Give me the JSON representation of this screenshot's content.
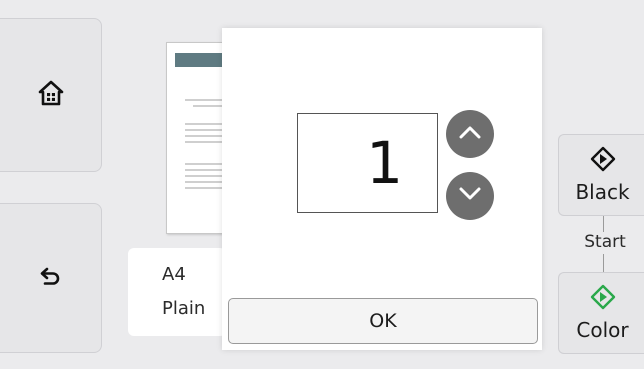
{
  "left_nav": {
    "home_icon": "home-icon",
    "back_icon": "back-arrow-icon"
  },
  "paper": {
    "size": "A4",
    "type": "Plain"
  },
  "copies": {
    "value": "1",
    "up_icon": "chevron-up-icon",
    "down_icon": "chevron-down-icon",
    "ok_label": "OK"
  },
  "start": {
    "label": "Start",
    "black_label": "Black",
    "color_label": "Color",
    "black_icon": "start-diamond-icon",
    "color_icon": "start-diamond-icon"
  },
  "colors": {
    "background": "#ebebed",
    "arrow_button": "#6e6e6e",
    "color_start_accent": "#2aa84a",
    "black_start_accent": "#111111"
  }
}
